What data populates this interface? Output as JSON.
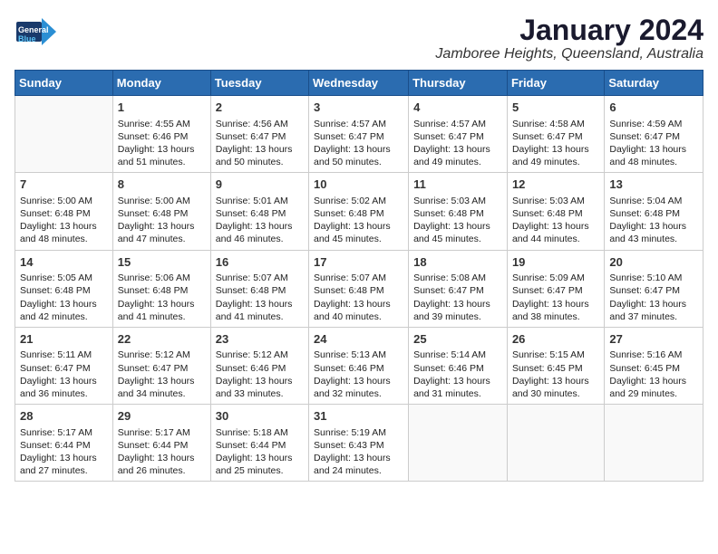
{
  "logo": {
    "text_general": "General",
    "text_blue": "Blue",
    "icon_unicode": "▶"
  },
  "header": {
    "month_year": "January 2024",
    "location": "Jamboree Heights, Queensland, Australia"
  },
  "weekdays": [
    "Sunday",
    "Monday",
    "Tuesday",
    "Wednesday",
    "Thursday",
    "Friday",
    "Saturday"
  ],
  "weeks": [
    [
      {
        "day": "",
        "info": ""
      },
      {
        "day": "1",
        "info": "Sunrise: 4:55 AM\nSunset: 6:46 PM\nDaylight: 13 hours\nand 51 minutes."
      },
      {
        "day": "2",
        "info": "Sunrise: 4:56 AM\nSunset: 6:47 PM\nDaylight: 13 hours\nand 50 minutes."
      },
      {
        "day": "3",
        "info": "Sunrise: 4:57 AM\nSunset: 6:47 PM\nDaylight: 13 hours\nand 50 minutes."
      },
      {
        "day": "4",
        "info": "Sunrise: 4:57 AM\nSunset: 6:47 PM\nDaylight: 13 hours\nand 49 minutes."
      },
      {
        "day": "5",
        "info": "Sunrise: 4:58 AM\nSunset: 6:47 PM\nDaylight: 13 hours\nand 49 minutes."
      },
      {
        "day": "6",
        "info": "Sunrise: 4:59 AM\nSunset: 6:47 PM\nDaylight: 13 hours\nand 48 minutes."
      }
    ],
    [
      {
        "day": "7",
        "info": "Sunrise: 5:00 AM\nSunset: 6:48 PM\nDaylight: 13 hours\nand 48 minutes."
      },
      {
        "day": "8",
        "info": "Sunrise: 5:00 AM\nSunset: 6:48 PM\nDaylight: 13 hours\nand 47 minutes."
      },
      {
        "day": "9",
        "info": "Sunrise: 5:01 AM\nSunset: 6:48 PM\nDaylight: 13 hours\nand 46 minutes."
      },
      {
        "day": "10",
        "info": "Sunrise: 5:02 AM\nSunset: 6:48 PM\nDaylight: 13 hours\nand 45 minutes."
      },
      {
        "day": "11",
        "info": "Sunrise: 5:03 AM\nSunset: 6:48 PM\nDaylight: 13 hours\nand 45 minutes."
      },
      {
        "day": "12",
        "info": "Sunrise: 5:03 AM\nSunset: 6:48 PM\nDaylight: 13 hours\nand 44 minutes."
      },
      {
        "day": "13",
        "info": "Sunrise: 5:04 AM\nSunset: 6:48 PM\nDaylight: 13 hours\nand 43 minutes."
      }
    ],
    [
      {
        "day": "14",
        "info": "Sunrise: 5:05 AM\nSunset: 6:48 PM\nDaylight: 13 hours\nand 42 minutes."
      },
      {
        "day": "15",
        "info": "Sunrise: 5:06 AM\nSunset: 6:48 PM\nDaylight: 13 hours\nand 41 minutes."
      },
      {
        "day": "16",
        "info": "Sunrise: 5:07 AM\nSunset: 6:48 PM\nDaylight: 13 hours\nand 41 minutes."
      },
      {
        "day": "17",
        "info": "Sunrise: 5:07 AM\nSunset: 6:48 PM\nDaylight: 13 hours\nand 40 minutes."
      },
      {
        "day": "18",
        "info": "Sunrise: 5:08 AM\nSunset: 6:47 PM\nDaylight: 13 hours\nand 39 minutes."
      },
      {
        "day": "19",
        "info": "Sunrise: 5:09 AM\nSunset: 6:47 PM\nDaylight: 13 hours\nand 38 minutes."
      },
      {
        "day": "20",
        "info": "Sunrise: 5:10 AM\nSunset: 6:47 PM\nDaylight: 13 hours\nand 37 minutes."
      }
    ],
    [
      {
        "day": "21",
        "info": "Sunrise: 5:11 AM\nSunset: 6:47 PM\nDaylight: 13 hours\nand 36 minutes."
      },
      {
        "day": "22",
        "info": "Sunrise: 5:12 AM\nSunset: 6:47 PM\nDaylight: 13 hours\nand 34 minutes."
      },
      {
        "day": "23",
        "info": "Sunrise: 5:12 AM\nSunset: 6:46 PM\nDaylight: 13 hours\nand 33 minutes."
      },
      {
        "day": "24",
        "info": "Sunrise: 5:13 AM\nSunset: 6:46 PM\nDaylight: 13 hours\nand 32 minutes."
      },
      {
        "day": "25",
        "info": "Sunrise: 5:14 AM\nSunset: 6:46 PM\nDaylight: 13 hours\nand 31 minutes."
      },
      {
        "day": "26",
        "info": "Sunrise: 5:15 AM\nSunset: 6:45 PM\nDaylight: 13 hours\nand 30 minutes."
      },
      {
        "day": "27",
        "info": "Sunrise: 5:16 AM\nSunset: 6:45 PM\nDaylight: 13 hours\nand 29 minutes."
      }
    ],
    [
      {
        "day": "28",
        "info": "Sunrise: 5:17 AM\nSunset: 6:44 PM\nDaylight: 13 hours\nand 27 minutes."
      },
      {
        "day": "29",
        "info": "Sunrise: 5:17 AM\nSunset: 6:44 PM\nDaylight: 13 hours\nand 26 minutes."
      },
      {
        "day": "30",
        "info": "Sunrise: 5:18 AM\nSunset: 6:44 PM\nDaylight: 13 hours\nand 25 minutes."
      },
      {
        "day": "31",
        "info": "Sunrise: 5:19 AM\nSunset: 6:43 PM\nDaylight: 13 hours\nand 24 minutes."
      },
      {
        "day": "",
        "info": ""
      },
      {
        "day": "",
        "info": ""
      },
      {
        "day": "",
        "info": ""
      }
    ]
  ]
}
